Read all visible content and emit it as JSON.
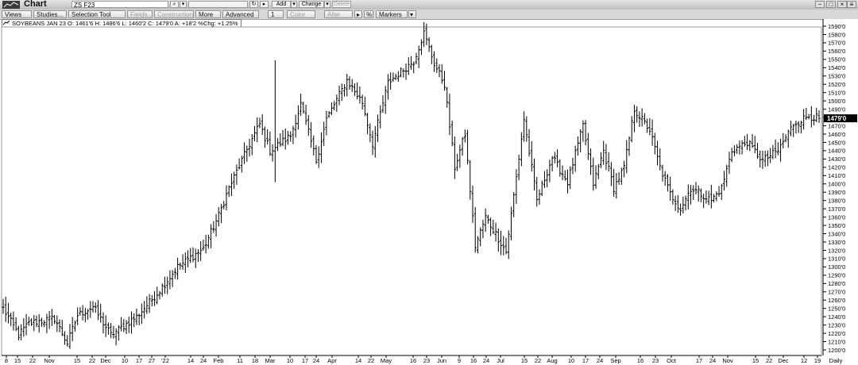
{
  "window": {
    "title": "Chart",
    "symbol_value": "ZS F23",
    "close_glyph": "×"
  },
  "toolbar": {
    "views_label": "Views",
    "studies_label": "Studies...",
    "selection_tool_label": "Selection Tool",
    "fields_label": "Fields...",
    "constructions_label": "Constructions",
    "more_label": "More",
    "advanced_label": "Advanced",
    "line_width_label": "1",
    "color_label": "Color",
    "alter_label": "Alter",
    "percent_label": "%",
    "markers_label": "Markers",
    "add_label": "Add",
    "change_label": "Change",
    "delete_label": "Delete"
  },
  "infobar": {
    "symbol": "SOYBEANS JAN 23",
    "open": "O: 1461'6",
    "high": "H: 1486'6",
    "low": "L: 1460'2",
    "close": "C: 1479'0",
    "change": "A: +18'2",
    "pct_change": "%Chg: +1.25%"
  },
  "colors": {
    "bar": "#000000",
    "grid": "#ffffff",
    "background": "#ffffff",
    "last_price_bg": "#000000",
    "last_price_fg": "#ffffff"
  },
  "chart_data": {
    "type": "ohlc",
    "title": "SOYBEANS JAN 23",
    "y_tick_labels": [
      "1200'0",
      "1210'0",
      "1220'0",
      "1230'0",
      "1240'0",
      "1250'0",
      "1260'0",
      "1270'0",
      "1280'0",
      "1290'0",
      "1300'0",
      "1310'0",
      "1320'0",
      "1330'0",
      "1340'0",
      "1350'0",
      "1360'0",
      "1370'0",
      "1380'0",
      "1390'0",
      "1400'0",
      "1410'0",
      "1420'0",
      "1430'0",
      "1440'0",
      "1450'0",
      "1460'0",
      "1470'0",
      "1480'0",
      "1490'0",
      "1500'0",
      "1510'0",
      "1520'0",
      "1530'0",
      "1540'0",
      "1550'0",
      "1560'0",
      "1570'0",
      "1580'0",
      "1590'0"
    ],
    "ylim": [
      1195,
      1595
    ],
    "last_price": 1479,
    "last_price_label": "1479'0",
    "x_tick_labels": [
      "8",
      "15",
      "22",
      "Nov",
      "15",
      "22",
      "Dec",
      "10",
      "17",
      "27",
      "'22",
      "14",
      "24",
      "Feb",
      "11",
      "18",
      "Mar",
      "10",
      "17",
      "24",
      "Apr",
      "14",
      "22",
      "May",
      "16",
      "23",
      "Jun",
      "9",
      "16",
      "24",
      "Jul",
      "15",
      "22",
      "Aug",
      "10",
      "17",
      "24",
      "Sep",
      "16",
      "23",
      "Oct",
      "17",
      "24",
      "Nov",
      "15",
      "22",
      "Dec",
      "12",
      "19",
      "Daily"
    ],
    "bar_interval": "Daily",
    "key_points": [
      {
        "i": 0,
        "c": 1250
      },
      {
        "i": 6,
        "c": 1218
      },
      {
        "i": 10,
        "c": 1232
      },
      {
        "i": 20,
        "c": 1238
      },
      {
        "i": 25,
        "c": 1208
      },
      {
        "i": 29,
        "c": 1242
      },
      {
        "i": 35,
        "c": 1252
      },
      {
        "i": 42,
        "c": 1218
      },
      {
        "i": 52,
        "c": 1240
      },
      {
        "i": 60,
        "c": 1268
      },
      {
        "i": 68,
        "c": 1300
      },
      {
        "i": 78,
        "c": 1322
      },
      {
        "i": 84,
        "c": 1362
      },
      {
        "i": 88,
        "c": 1395
      },
      {
        "i": 96,
        "c": 1448
      },
      {
        "i": 100,
        "c": 1472
      },
      {
        "i": 104,
        "c": 1440
      },
      {
        "i": 112,
        "c": 1458
      },
      {
        "i": 116,
        "c": 1496
      },
      {
        "i": 122,
        "c": 1428
      },
      {
        "i": 126,
        "c": 1478
      },
      {
        "i": 134,
        "c": 1525
      },
      {
        "i": 140,
        "c": 1498
      },
      {
        "i": 144,
        "c": 1448
      },
      {
        "i": 150,
        "c": 1522
      },
      {
        "i": 160,
        "c": 1548
      },
      {
        "i": 164,
        "c": 1582
      },
      {
        "i": 168,
        "c": 1545
      },
      {
        "i": 172,
        "c": 1520
      },
      {
        "i": 176,
        "c": 1420
      },
      {
        "i": 180,
        "c": 1460
      },
      {
        "i": 184,
        "c": 1325
      },
      {
        "i": 188,
        "c": 1360
      },
      {
        "i": 192,
        "c": 1340
      },
      {
        "i": 196,
        "c": 1318
      },
      {
        "i": 200,
        "c": 1408
      },
      {
        "i": 203,
        "c": 1478
      },
      {
        "i": 208,
        "c": 1380
      },
      {
        "i": 214,
        "c": 1432
      },
      {
        "i": 220,
        "c": 1402
      },
      {
        "i": 226,
        "c": 1470
      },
      {
        "i": 230,
        "c": 1400
      },
      {
        "i": 234,
        "c": 1440
      },
      {
        "i": 238,
        "c": 1395
      },
      {
        "i": 242,
        "c": 1420
      },
      {
        "i": 246,
        "c": 1490
      },
      {
        "i": 252,
        "c": 1465
      },
      {
        "i": 256,
        "c": 1420
      },
      {
        "i": 260,
        "c": 1388
      },
      {
        "i": 264,
        "c": 1370
      },
      {
        "i": 268,
        "c": 1395
      },
      {
        "i": 272,
        "c": 1388
      },
      {
        "i": 276,
        "c": 1380
      },
      {
        "i": 280,
        "c": 1395
      },
      {
        "i": 284,
        "c": 1440
      },
      {
        "i": 290,
        "c": 1450
      },
      {
        "i": 296,
        "c": 1428
      },
      {
        "i": 302,
        "c": 1440
      },
      {
        "i": 308,
        "c": 1472
      },
      {
        "i": 314,
        "c": 1482
      },
      {
        "i": 318,
        "c": 1479
      }
    ]
  }
}
